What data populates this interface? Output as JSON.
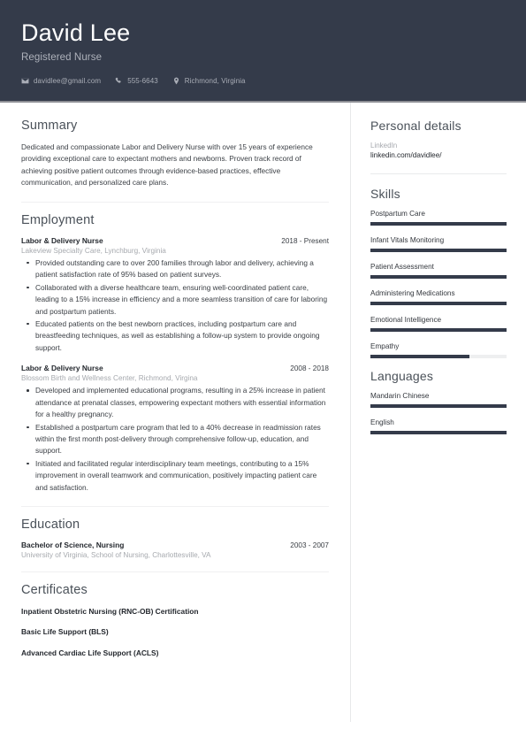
{
  "header": {
    "name": "David Lee",
    "job_title": "Registered Nurse",
    "contacts": [
      {
        "icon": "envelope-icon",
        "name": "contact-email",
        "value": "davidlee@gmail.com"
      },
      {
        "icon": "phone-icon",
        "name": "contact-phone",
        "value": "555-6643"
      },
      {
        "icon": "location-pin-icon",
        "name": "contact-location",
        "value": "Richmond, Virginia"
      }
    ],
    "background_color": "#343b4a"
  },
  "main": {
    "summary": {
      "title": "Summary",
      "text": "Dedicated and compassionate Labor and Delivery Nurse with over 15 years of experience providing exceptional care to expectant mothers and newborns. Proven track record of achieving positive patient outcomes through evidence-based practices, effective communication, and personalized care plans."
    },
    "employment": {
      "title": "Employment",
      "entries": [
        {
          "title": "Labor & Delivery Nurse",
          "date": "2018 - Present",
          "organization": "Lakeview Specialty Care, Lynchburg, Virginia",
          "bullets": [
            "Provided outstanding care to over 200 families through labor and delivery, achieving a patient satisfaction rate of 95% based on patient surveys.",
            "Collaborated with a diverse healthcare team, ensuring well-coordinated patient care, leading to a 15% increase in efficiency and a more seamless transition of care for laboring and postpartum patients.",
            "Educated patients on the best newborn practices, including postpartum care and breastfeeding techniques, as well as establishing a follow-up system to provide ongoing support."
          ]
        },
        {
          "title": "Labor & Delivery Nurse",
          "date": "2008 - 2018",
          "organization": "Blossom Birth and Wellness Center, Richmond, Virgina",
          "bullets": [
            "Developed and implemented educational programs, resulting in a 25% increase in patient attendance at prenatal classes, empowering expectant mothers with essential information for a healthy pregnancy.",
            "Established a postpartum care program that led to a 40% decrease in readmission rates within the first month post-delivery through comprehensive follow-up, education, and support.",
            "Initiated and facilitated regular interdisciplinary team meetings, contributing to a 15% improvement in overall teamwork and communication, positively impacting patient care and satisfaction."
          ]
        }
      ]
    },
    "education": {
      "title": "Education",
      "entries": [
        {
          "title": "Bachelor of Science, Nursing",
          "date": "2003 - 2007",
          "organization": "University of Virginia, School of Nursing, Charlottesville, VA"
        }
      ]
    },
    "certificates": {
      "title": "Certificates",
      "items": [
        "Inpatient Obstetric Nursing (RNC-OB) Certification",
        "Basic Life Support (BLS)",
        "Advanced Cardiac Life Support (ACLS)"
      ]
    }
  },
  "sidebar": {
    "personal_details": {
      "title": "Personal details",
      "fields": [
        {
          "label": "LinkedIn",
          "value": "linkedin.com/davidlee/"
        }
      ]
    },
    "skills": {
      "title": "Skills",
      "bar_color": "#343b4a",
      "track_color": "#eeeff0",
      "items": [
        {
          "name": "Postpartum Care",
          "level": 100
        },
        {
          "name": "Infant Vitals Monitoring",
          "level": 100
        },
        {
          "name": "Patient Assessment",
          "level": 100
        },
        {
          "name": "Administering Medications",
          "level": 100
        },
        {
          "name": "Emotional Intelligence",
          "level": 100
        },
        {
          "name": "Empathy",
          "level": 73
        }
      ]
    },
    "languages": {
      "title": "Languages",
      "items": [
        {
          "name": "Mandarin Chinese",
          "level": 100
        },
        {
          "name": "English",
          "level": 100
        }
      ]
    }
  }
}
